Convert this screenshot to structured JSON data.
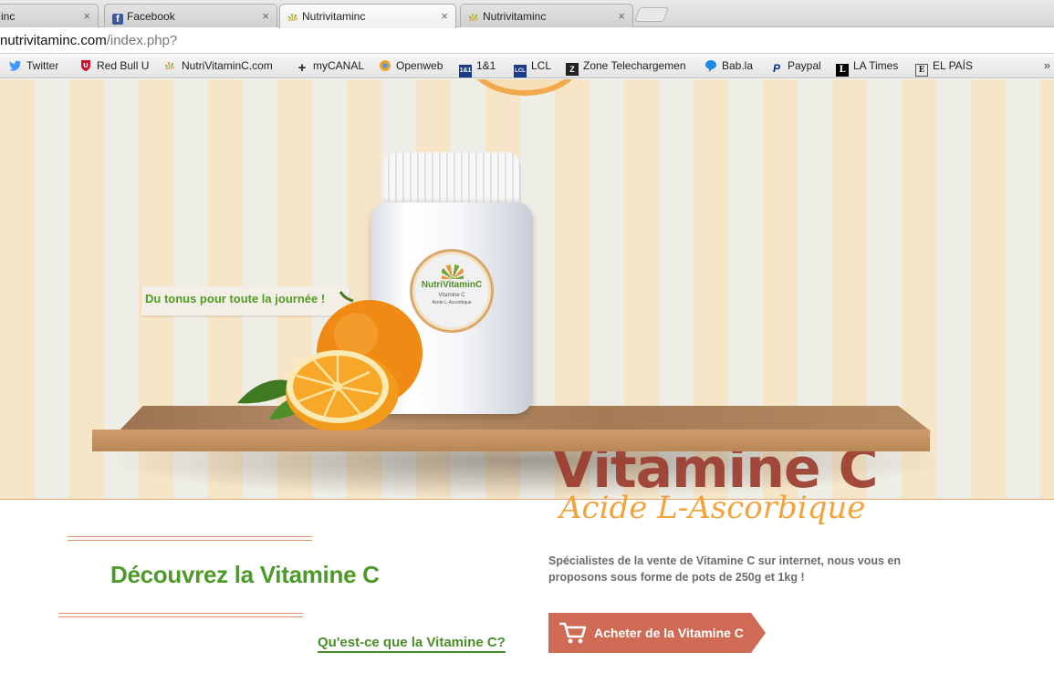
{
  "browser": {
    "tabs": [
      {
        "title": "inc",
        "favicon": "nutrivitamin-icon",
        "active": false
      },
      {
        "title": "Facebook",
        "favicon": "facebook-icon",
        "active": false
      },
      {
        "title": "Nutrivitaminc",
        "favicon": "nutrivitamin-icon",
        "active": true
      },
      {
        "title": "Nutrivitaminc",
        "favicon": "nutrivitamin-icon",
        "active": false
      }
    ],
    "tab_close_glyph": "×",
    "url_host": "nutrivitaminc.com",
    "url_path": "/index.php?",
    "bookmarks": [
      {
        "label": "Twitter",
        "icon": "twitter-icon",
        "color": "#4099ff"
      },
      {
        "label": "Red Bull U",
        "icon": "redbull-shield-icon",
        "color": "#c8102e"
      },
      {
        "label": "NutriVitaminC.com",
        "icon": "nutrivitamin-icon",
        "color": "#e8a33a"
      },
      {
        "label": "myCANAL",
        "icon": "plus-icon",
        "color": "#000000"
      },
      {
        "label": "Openweb",
        "icon": "openweb-icon",
        "color": "#f0a030"
      },
      {
        "label": "1&1",
        "icon": "oneandone-icon",
        "color": "#1b3c87"
      },
      {
        "label": "LCL",
        "icon": "lcl-icon",
        "color": "#1a3b8a"
      },
      {
        "label": "Zone Telechargemen",
        "icon": "zone-icon",
        "color": "#222222"
      },
      {
        "label": "Bab.la",
        "icon": "speech-bubble-icon",
        "color": "#1e88e5"
      },
      {
        "label": "Paypal",
        "icon": "paypal-icon",
        "color": "#003087"
      },
      {
        "label": "LA Times",
        "icon": "latimes-icon",
        "color": "#000000"
      },
      {
        "label": "EL PAÍS",
        "icon": "elpais-icon",
        "color": "#333333"
      }
    ],
    "bookmarks_overflow": "»"
  },
  "hero": {
    "tagline": "Du tonus pour toute la journée !",
    "jar_label": {
      "brand": "NutriVitaminC",
      "line1": "Vitamine C",
      "line2": "Acide L-Ascorbique"
    },
    "big_title": "Vitamine C"
  },
  "content": {
    "subtitle": "Acide L-Ascorbique",
    "section_title": "Découvrez la Vitamine C",
    "what_link": "Qu'est-ce que la Vitamine C?",
    "description": "Spécialistes de la vente de Vitamine C sur internet, nous vous en proposons sous forme de pots de 250g et 1kg !",
    "buy_button": "Acheter de la Vitamine C"
  },
  "colors": {
    "brand_green": "#4d9a2a",
    "accent_orange": "#f3a33c",
    "button_red": "#cf6b55"
  }
}
